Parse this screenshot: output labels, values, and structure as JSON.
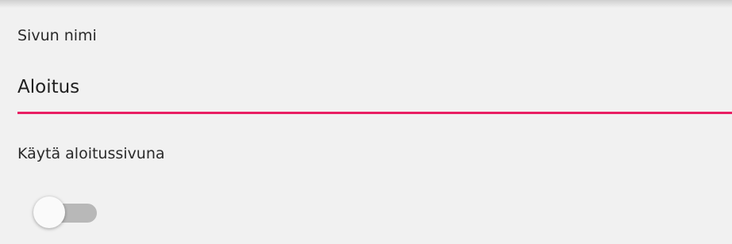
{
  "page_name_field": {
    "label": "Sivun nimi",
    "value": "Aloitus",
    "accent_color": "#e91e63"
  },
  "start_page_toggle": {
    "label": "Käytä aloitussivuna",
    "checked": false
  }
}
